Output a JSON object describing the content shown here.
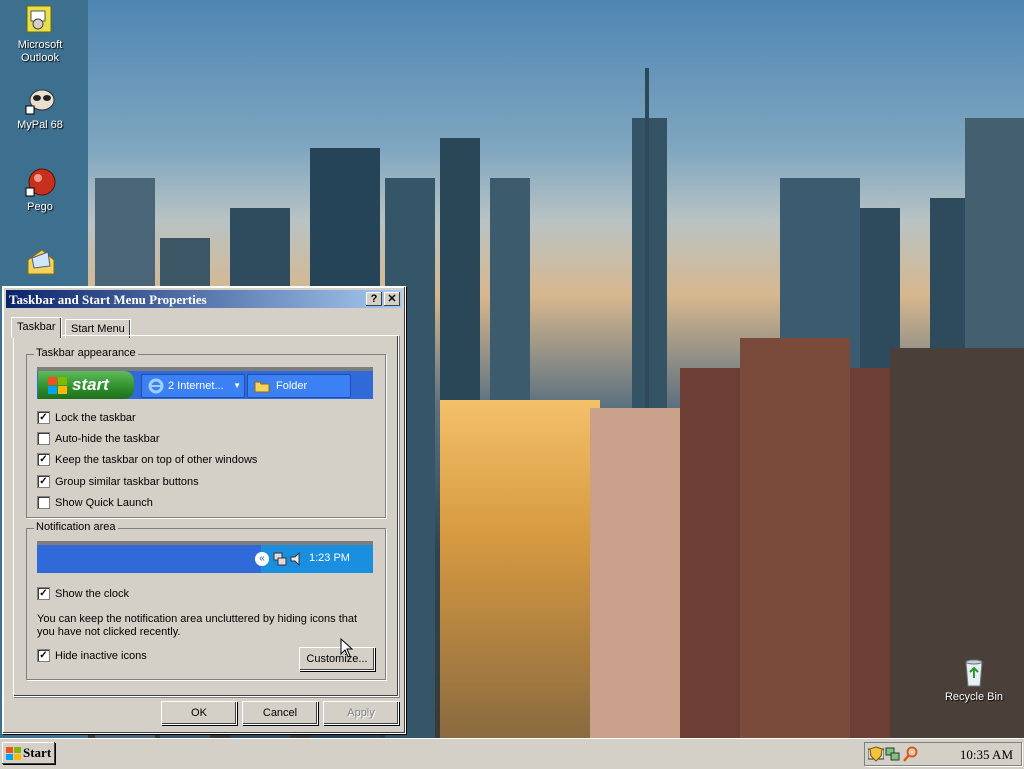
{
  "desktop": {
    "icons": [
      {
        "label": "Microsoft\nOutlook",
        "icon": "outlook-icon"
      },
      {
        "label": "MyPal 68",
        "icon": "mypal-icon"
      },
      {
        "label": "Pego",
        "icon": "pego-icon"
      },
      {
        "label": "",
        "icon": "mail-folder-icon"
      },
      {
        "label": "Recycle Bin",
        "icon": "recycle-bin-icon"
      }
    ]
  },
  "dialog": {
    "title": "Taskbar and Start Menu Properties",
    "help_btn": "?",
    "close_btn": "✕",
    "tabs": [
      {
        "label": "Taskbar",
        "active": true
      },
      {
        "label": "Start Menu",
        "active": false
      }
    ],
    "appearance": {
      "group_label": "Taskbar appearance",
      "preview": {
        "start_label": "start",
        "button1": "2 Internet...",
        "button2": "Folder"
      },
      "options": [
        {
          "label": "Lock the taskbar",
          "checked": true
        },
        {
          "label": "Auto-hide the taskbar",
          "checked": false
        },
        {
          "label": "Keep the taskbar on top of other windows",
          "checked": true
        },
        {
          "label": "Group similar taskbar buttons",
          "checked": true
        },
        {
          "label": "Show Quick Launch",
          "checked": false
        }
      ]
    },
    "notification": {
      "group_label": "Notification area",
      "preview_time": "1:23 PM",
      "show_clock": {
        "label": "Show the clock",
        "checked": true
      },
      "description": "You can keep the notification area uncluttered by hiding icons that you have not clicked recently.",
      "hide_inactive": {
        "label": "Hide inactive icons",
        "checked": true
      },
      "customize_label": "Customize..."
    },
    "buttons": {
      "ok": "OK",
      "cancel": "Cancel",
      "apply": "Apply"
    }
  },
  "taskbar": {
    "start_label": "Start",
    "clock": "10:35 AM"
  },
  "colors": {
    "title_start": "#0a246a",
    "title_end": "#a6caf0",
    "face": "#d4d0c8",
    "xp_blue": "#2f6ad8",
    "xp_green": "#2e8f2b"
  }
}
